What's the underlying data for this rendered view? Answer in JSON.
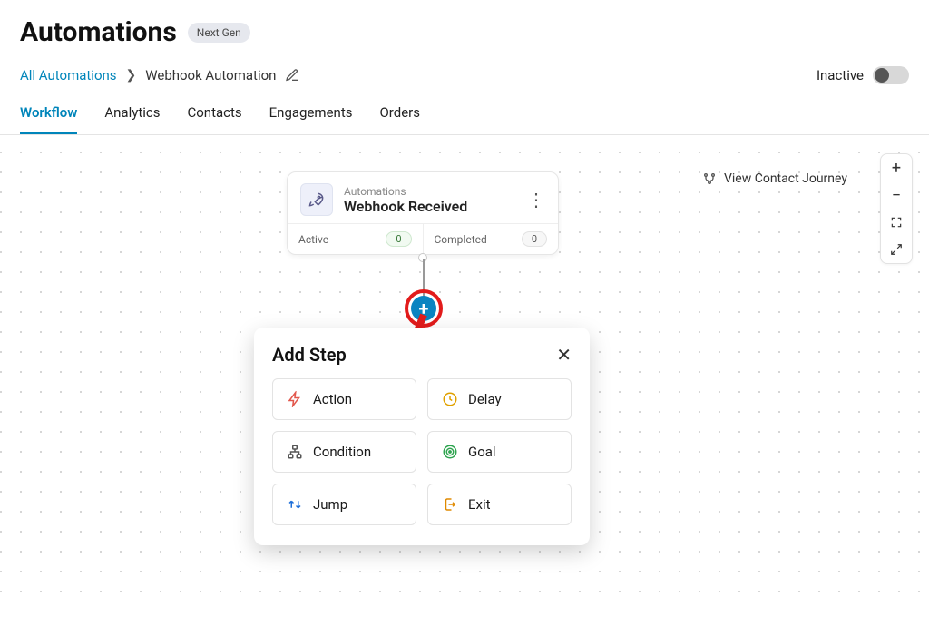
{
  "page": {
    "title": "Automations",
    "badge": "Next Gen"
  },
  "breadcrumb": {
    "root": "All Automations",
    "current": "Webhook Automation"
  },
  "status": {
    "label": "Inactive"
  },
  "tabs": [
    "Workflow",
    "Analytics",
    "Contacts",
    "Engagements",
    "Orders"
  ],
  "journey_link": "View Contact Journey",
  "node": {
    "supertitle": "Automations",
    "title": "Webhook Received",
    "stats": {
      "active_label": "Active",
      "active_value": "0",
      "completed_label": "Completed",
      "completed_value": "0"
    }
  },
  "popover": {
    "title": "Add Step"
  },
  "steps": {
    "action": "Action",
    "delay": "Delay",
    "condition": "Condition",
    "goal": "Goal",
    "jump": "Jump",
    "exit": "Exit"
  }
}
